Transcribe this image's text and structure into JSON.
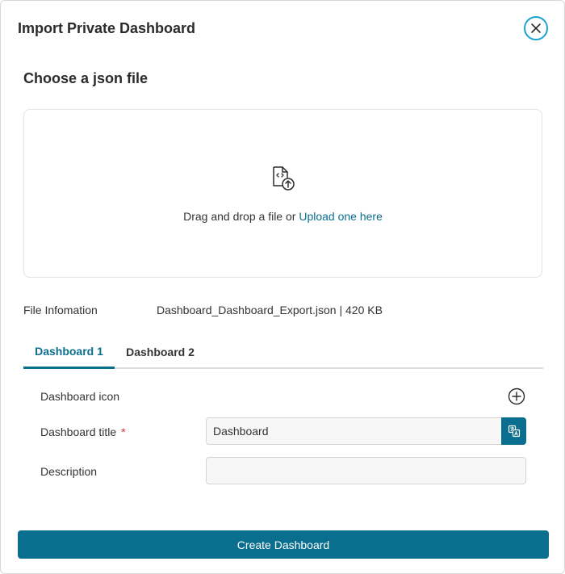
{
  "dialog": {
    "title": "Import Private Dashboard",
    "close_icon": "close-icon"
  },
  "upload": {
    "section_title": "Choose a json file",
    "icon": "file-upload-icon",
    "prompt_text": "Drag and drop a file or ",
    "link_text": "Upload one here"
  },
  "file_info": {
    "label": "File Infomation",
    "value": "Dashboard_Dashboard_Export.json | 420 KB"
  },
  "tabs": [
    {
      "label": "Dashboard 1",
      "active": true
    },
    {
      "label": "Dashboard 2",
      "active": false
    }
  ],
  "form": {
    "icon_label": "Dashboard icon",
    "add_icon": "plus-circle-icon",
    "title_label": "Dashboard title",
    "required_mark": "*",
    "title_value": "Dashboard",
    "translate_icon": "translate-icon",
    "description_label": "Description",
    "description_value": ""
  },
  "actions": {
    "create_label": "Create Dashboard"
  },
  "colors": {
    "accent": "#0a6e8e",
    "close_ring": "#1aa3d1",
    "required": "#d03030"
  }
}
